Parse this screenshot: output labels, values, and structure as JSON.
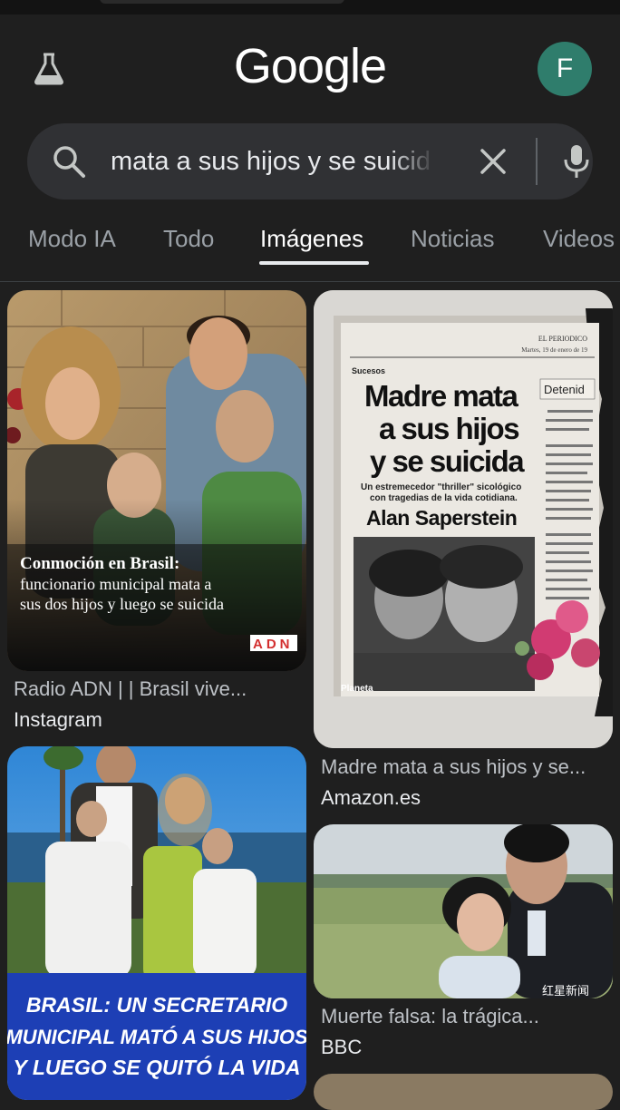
{
  "header": {
    "logo_text": "Google",
    "avatar_letter": "F",
    "labs_icon": "flask-icon"
  },
  "search": {
    "query": "mata a sus hijos y se suicida",
    "icons": [
      "search-icon",
      "close-icon",
      "mic-icon"
    ]
  },
  "tabs": [
    {
      "label": "Modo IA"
    },
    {
      "label": "Todo"
    },
    {
      "label": "Imágenes",
      "active": true
    },
    {
      "label": "Noticias"
    },
    {
      "label": "Videos"
    }
  ],
  "results": {
    "card1": {
      "overlay_heading": "Conmoción en Brasil:",
      "overlay_line1": "funcionario municipal mata a",
      "overlay_line2": "sus dos hijos y luego se suicida",
      "badge": "ADN",
      "title": "Radio ADN | | Brasil vive...",
      "source": "Instagram"
    },
    "card2": {
      "paper_name": "EL PERIODICO",
      "paper_date": "Martes, 19 de enero de 19",
      "section": "Sucesos",
      "side_title": "Detenid",
      "headline_1": "Madre mata",
      "headline_2": "a sus hijos",
      "headline_3": "y se suicida",
      "subhead_1": "Un estremecedor \"thriller\" sicológico",
      "subhead_2": "con tragedias de la vida cotidiana.",
      "author": "Alan Saperstein",
      "publisher": "Planeta",
      "title": "Madre mata a sus hijos y se...",
      "source": "Amazon.es"
    },
    "card3": {
      "banner_line1": "BRASIL: UN SECRETARIO",
      "banner_line2": "MUNICIPAL MATÓ A SUS HIJOS",
      "banner_line3": "Y LUEGO SE QUITÓ LA VIDA"
    },
    "card4": {
      "watermark": "红星新闻",
      "title": "Muerte falsa: la trágica...",
      "source": "BBC"
    }
  }
}
